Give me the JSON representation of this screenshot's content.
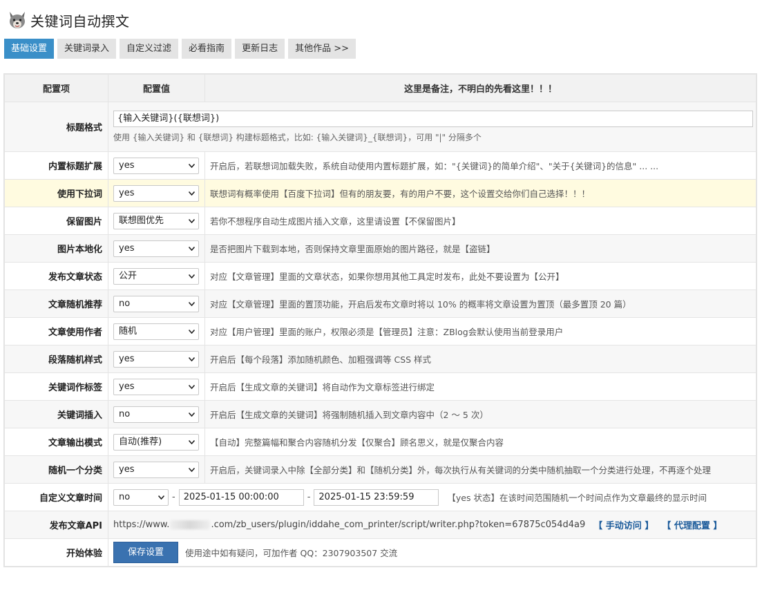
{
  "app": {
    "title": "关键词自动撰文",
    "logo_icon": "wolf-icon"
  },
  "tabs": [
    {
      "label": "基础设置",
      "active": true
    },
    {
      "label": "关键词录入",
      "active": false
    },
    {
      "label": "自定义过滤",
      "active": false
    },
    {
      "label": "必看指南",
      "active": false
    },
    {
      "label": "更新日志",
      "active": false
    },
    {
      "label": "其他作品 >>",
      "active": false
    }
  ],
  "table": {
    "headers": [
      "配置项",
      "配置值",
      "这里是备注，不明白的先看这里！！！"
    ],
    "title_format": {
      "label": "标题格式",
      "value": "{输入关键词}({联想词})",
      "hint": "使用 {输入关键词} 和 {联想词} 构建标题格式，比如: {输入关键词}_{联想词}，可用 \"|\" 分隔多个"
    },
    "rows": [
      {
        "label": "内置标题扩展",
        "value": "yes",
        "note": "开启后，若联想词加载失败，系统自动使用内置标题扩展，如：\"{关键词}的简单介绍\"、\"关于{关键词}的信息\" ... ..."
      },
      {
        "label": "使用下拉词",
        "value": "yes",
        "note": "联想词有概率使用【百度下拉词】但有的朋友要，有的用户不要，这个设置交给你们自己选择！！！"
      },
      {
        "label": "保留图片",
        "value": "联想图优先",
        "note": "若你不想程序自动生成图片插入文章，这里请设置【不保留图片】"
      },
      {
        "label": "图片本地化",
        "value": "yes",
        "note": "是否把图片下载到本地，否则保持文章里面原始的图片路径，就是【盗链】"
      },
      {
        "label": "发布文章状态",
        "value": "公开",
        "note": "对应【文章管理】里面的文章状态，如果你想用其他工具定时发布，此处不要设置为【公开】"
      },
      {
        "label": "文章随机推荐",
        "value": "no",
        "note": "对应【文章管理】里面的置顶功能，开启后发布文章时将以 10% 的概率将文章设置为置顶（最多置顶 20 篇）"
      },
      {
        "label": "文章使用作者",
        "value": "随机",
        "note": "对应【用户管理】里面的账户，权限必须是【管理员】注意：ZBlog会默认使用当前登录用户"
      },
      {
        "label": "段落随机样式",
        "value": "yes",
        "note": "开启后【每个段落】添加随机颜色、加粗强调等 CSS 样式"
      },
      {
        "label": "关键词作标签",
        "value": "yes",
        "note": "开启后【生成文章的关键词】将自动作为文章标签进行绑定"
      },
      {
        "label": "关键词插入",
        "value": "no",
        "note": "开启后【生成文章的关键词】将强制随机插入到文章内容中（2 ～ 5 次）"
      },
      {
        "label": "文章输出模式",
        "value": "自动(推荐)",
        "note": "【自动】完整篇幅和聚合内容随机分发【仅聚合】顾名思义，就是仅聚合内容"
      },
      {
        "label": "随机一个分类",
        "value": "yes",
        "note": "开启后，关键词录入中除【全部分类】和【随机分类】外，每次执行从有关键词的分类中随机抽取一个分类进行处理，不再逐个处理"
      }
    ],
    "custom_time": {
      "label": "自定义文章时间",
      "value": "no",
      "start": "2025-01-15 00:00:00",
      "end": "2025-01-15 23:59:59",
      "note": "【yes 状态】在该时间范围随机一个时间点作为文章最终的显示时间"
    },
    "api": {
      "label": "发布文章API",
      "url_prefix": "https://www.",
      "url_suffix": ".com/zb_users/plugin/iddahe_com_printer/script/writer.php?token=67875c054d4a9",
      "manual_link": "【 手动访问 】",
      "proxy_link": "【 代理配置 】"
    },
    "start": {
      "label": "开始体验",
      "save_label": "保存设置",
      "contact": "使用途中如有疑问，可加作者 QQ：2307903507 交流"
    }
  },
  "colors": {
    "accent": "#3a8fc8",
    "save": "#3a72b0",
    "highlight_row": "#fffbe0",
    "link": "#1a5a9a"
  }
}
